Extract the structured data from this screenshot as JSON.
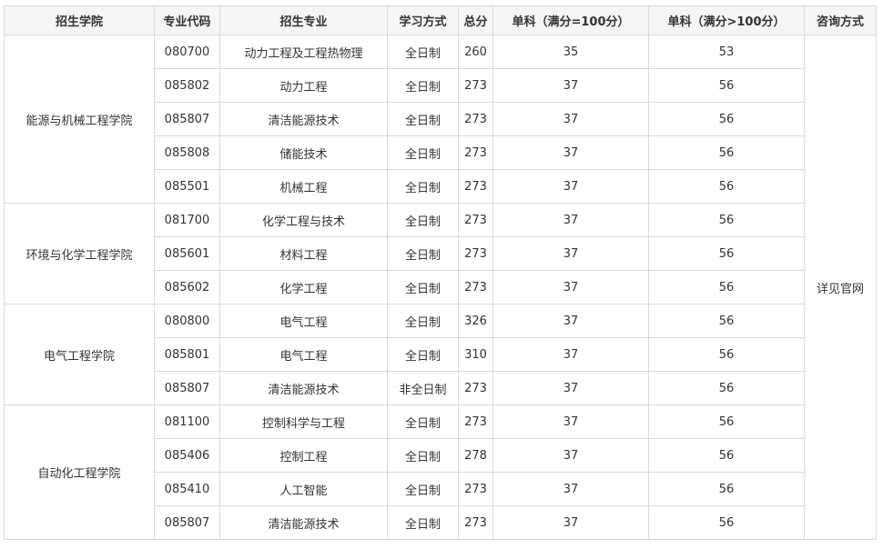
{
  "headers": {
    "college": "招生学院",
    "code": "专业代码",
    "major": "招生专业",
    "mode": "学习方式",
    "total": "总分",
    "single100": "单科（满分=100分）",
    "single_over100": "单科（满分>100分）",
    "consult": "咨询方式"
  },
  "consult_text": "详见官网",
  "groups": [
    {
      "college": "能源与机械工程学院",
      "rows": [
        {
          "code": "080700",
          "major": "动力工程及工程热物理",
          "mode": "全日制",
          "total": "260",
          "single100": "35",
          "single_over100": "53"
        },
        {
          "code": "085802",
          "major": "动力工程",
          "mode": "全日制",
          "total": "273",
          "single100": "37",
          "single_over100": "56"
        },
        {
          "code": "085807",
          "major": "清洁能源技术",
          "mode": "全日制",
          "total": "273",
          "single100": "37",
          "single_over100": "56"
        },
        {
          "code": "085808",
          "major": "储能技术",
          "mode": "全日制",
          "total": "273",
          "single100": "37",
          "single_over100": "56"
        },
        {
          "code": "085501",
          "major": "机械工程",
          "mode": "全日制",
          "total": "273",
          "single100": "37",
          "single_over100": "56"
        }
      ]
    },
    {
      "college": "环境与化学工程学院",
      "rows": [
        {
          "code": "081700",
          "major": "化学工程与技术",
          "mode": "全日制",
          "total": "273",
          "single100": "37",
          "single_over100": "56"
        },
        {
          "code": "085601",
          "major": "材料工程",
          "mode": "全日制",
          "total": "273",
          "single100": "37",
          "single_over100": "56"
        },
        {
          "code": "085602",
          "major": "化学工程",
          "mode": "全日制",
          "total": "273",
          "single100": "37",
          "single_over100": "56"
        }
      ]
    },
    {
      "college": "电气工程学院",
      "rows": [
        {
          "code": "080800",
          "major": "电气工程",
          "mode": "全日制",
          "total": "326",
          "single100": "37",
          "single_over100": "56"
        },
        {
          "code": "085801",
          "major": "电气工程",
          "mode": "全日制",
          "total": "310",
          "single100": "37",
          "single_over100": "56"
        },
        {
          "code": "085807",
          "major": "清洁能源技术",
          "mode": "非全日制",
          "total": "273",
          "single100": "37",
          "single_over100": "56"
        }
      ]
    },
    {
      "college": "自动化工程学院",
      "rows": [
        {
          "code": "081100",
          "major": "控制科学与工程",
          "mode": "全日制",
          "total": "273",
          "single100": "37",
          "single_over100": "56"
        },
        {
          "code": "085406",
          "major": "控制工程",
          "mode": "全日制",
          "total": "278",
          "single100": "37",
          "single_over100": "56"
        },
        {
          "code": "085410",
          "major": "人工智能",
          "mode": "全日制",
          "total": "273",
          "single100": "37",
          "single_over100": "56"
        },
        {
          "code": "085807",
          "major": "清洁能源技术",
          "mode": "全日制",
          "total": "273",
          "single100": "37",
          "single_over100": "56"
        }
      ]
    }
  ]
}
